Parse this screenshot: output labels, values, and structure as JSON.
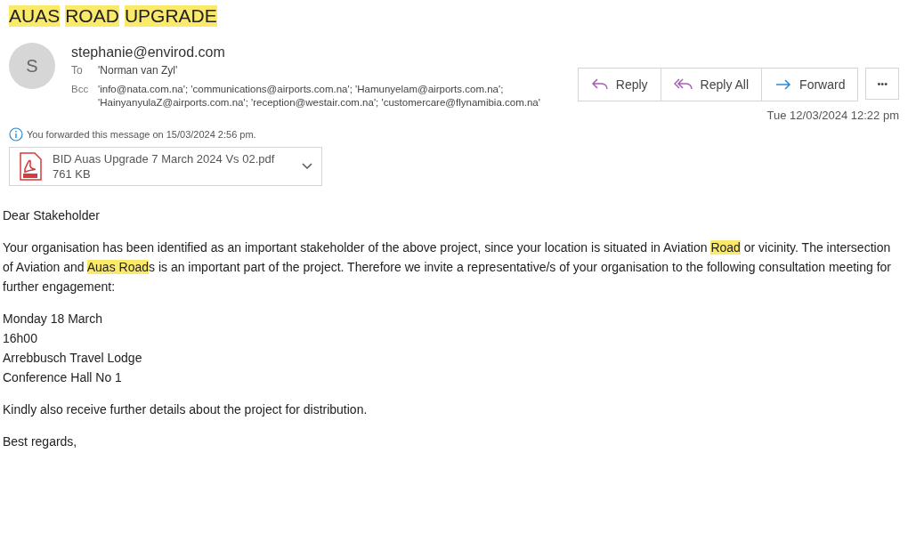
{
  "subject": [
    {
      "text": "AUAS",
      "highlight": true
    },
    {
      "text": "ROAD",
      "highlight": true
    },
    {
      "text": "UPGRADE",
      "highlight": true
    }
  ],
  "sender": {
    "avatar_initial": "S",
    "address": "stephanie@envirod.com"
  },
  "to": {
    "label": "To",
    "value": "'Norman van Zyl'"
  },
  "bcc": {
    "label": "Bcc",
    "lines": [
      "'info@nata.com.na'; 'communications@airports.com.na'; 'Hamunyelam@airports.com.na';",
      "'HainyanyulaZ@airports.com.na'; 'reception@westair.com.na'; 'customercare@flynamibia.com.na'"
    ]
  },
  "actions": [
    {
      "kind": "reply",
      "label": "Reply"
    },
    {
      "kind": "reply_all",
      "label": "Reply All"
    },
    {
      "kind": "forward",
      "label": "Forward"
    },
    {
      "kind": "more",
      "label": "•••"
    }
  ],
  "date": "Tue 12/03/2024 12:22 pm",
  "info": "You forwarded this message on 15/03/2024 2:56 pm.",
  "attachment": {
    "name": "BID Auas Upgrade 7 March 2024 Vs 02.pdf",
    "size": "761 KB"
  },
  "body": [
    {
      "kind": "para",
      "segments": [
        {
          "text": "Dear Stakeholder",
          "highlight": false
        }
      ]
    },
    {
      "kind": "para",
      "segments": [
        {
          "text": "Your organisation has been identified as an important stakeholder of the above project, since your location is situated in Aviation ",
          "highlight": false
        },
        {
          "text": "Road",
          "highlight": true
        },
        {
          "text": " or vicinity.  The intersection of Aviation and ",
          "highlight": false
        },
        {
          "text": "Auas Road",
          "highlight": true
        },
        {
          "text": "s is an important part of the project.  Therefore we invite a representative/s of your organisation to the following consultation meeting for further engagement:",
          "highlight": false
        }
      ]
    },
    {
      "kind": "lines",
      "lines": [
        "Monday 18 March",
        "16h00",
        "Arrebbusch Travel Lodge",
        "Conference Hall No 1"
      ]
    },
    {
      "kind": "para",
      "segments": [
        {
          "text": "Kindly also receive further details about the project for distribution.",
          "highlight": false
        }
      ]
    },
    {
      "kind": "para",
      "segments": [
        {
          "text": "Best regards,",
          "highlight": false
        }
      ]
    }
  ]
}
